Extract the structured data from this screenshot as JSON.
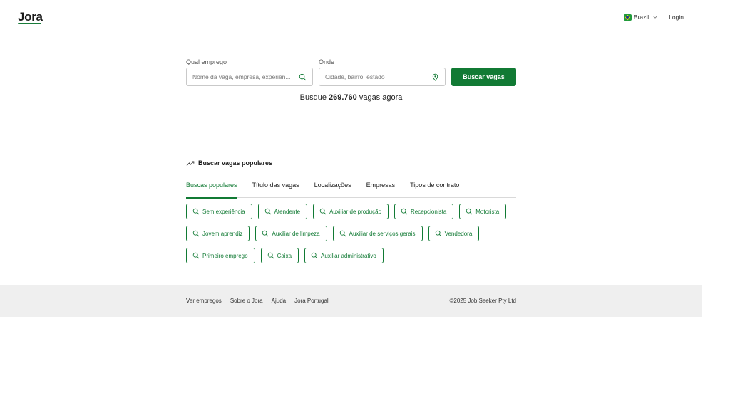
{
  "header": {
    "logo": "Jora",
    "country": "Brazil",
    "login": "Login"
  },
  "search": {
    "what_label": "Qual emprego",
    "what_placeholder": "Nome da vaga, empresa, experiên...",
    "where_label": "Onde",
    "where_placeholder": "Cidade, bairro, estado",
    "button": "Buscar vagas",
    "count_prefix": "Busque",
    "count": "269.760",
    "count_suffix": "vagas agora"
  },
  "popular": {
    "title": "Buscar vagas populares",
    "tabs": [
      "Buscas populares",
      "Título das vagas",
      "Localizações",
      "Empresas",
      "Tipos de contrato"
    ],
    "chips": [
      [
        "Sem experiência",
        "Atendente",
        "Auxiliar de produção",
        "Recepcionista",
        "Motorista"
      ],
      [
        "Jovem aprendiz",
        "Auxiliar de limpeza",
        "Auxiliar de serviços gerais",
        "Vendedora"
      ],
      [
        "Primeiro emprego",
        "Caixa",
        "Auxiliar administrativo"
      ]
    ]
  },
  "footer": {
    "links": [
      "Ver empregos",
      "Sobre o Jora",
      "Ajuda",
      "Jora Portugal"
    ],
    "copyright": "©2025 Job Seeker Pty Ltd"
  },
  "colors": {
    "brand_green": "#117a34",
    "footer_bg": "#efefef"
  }
}
